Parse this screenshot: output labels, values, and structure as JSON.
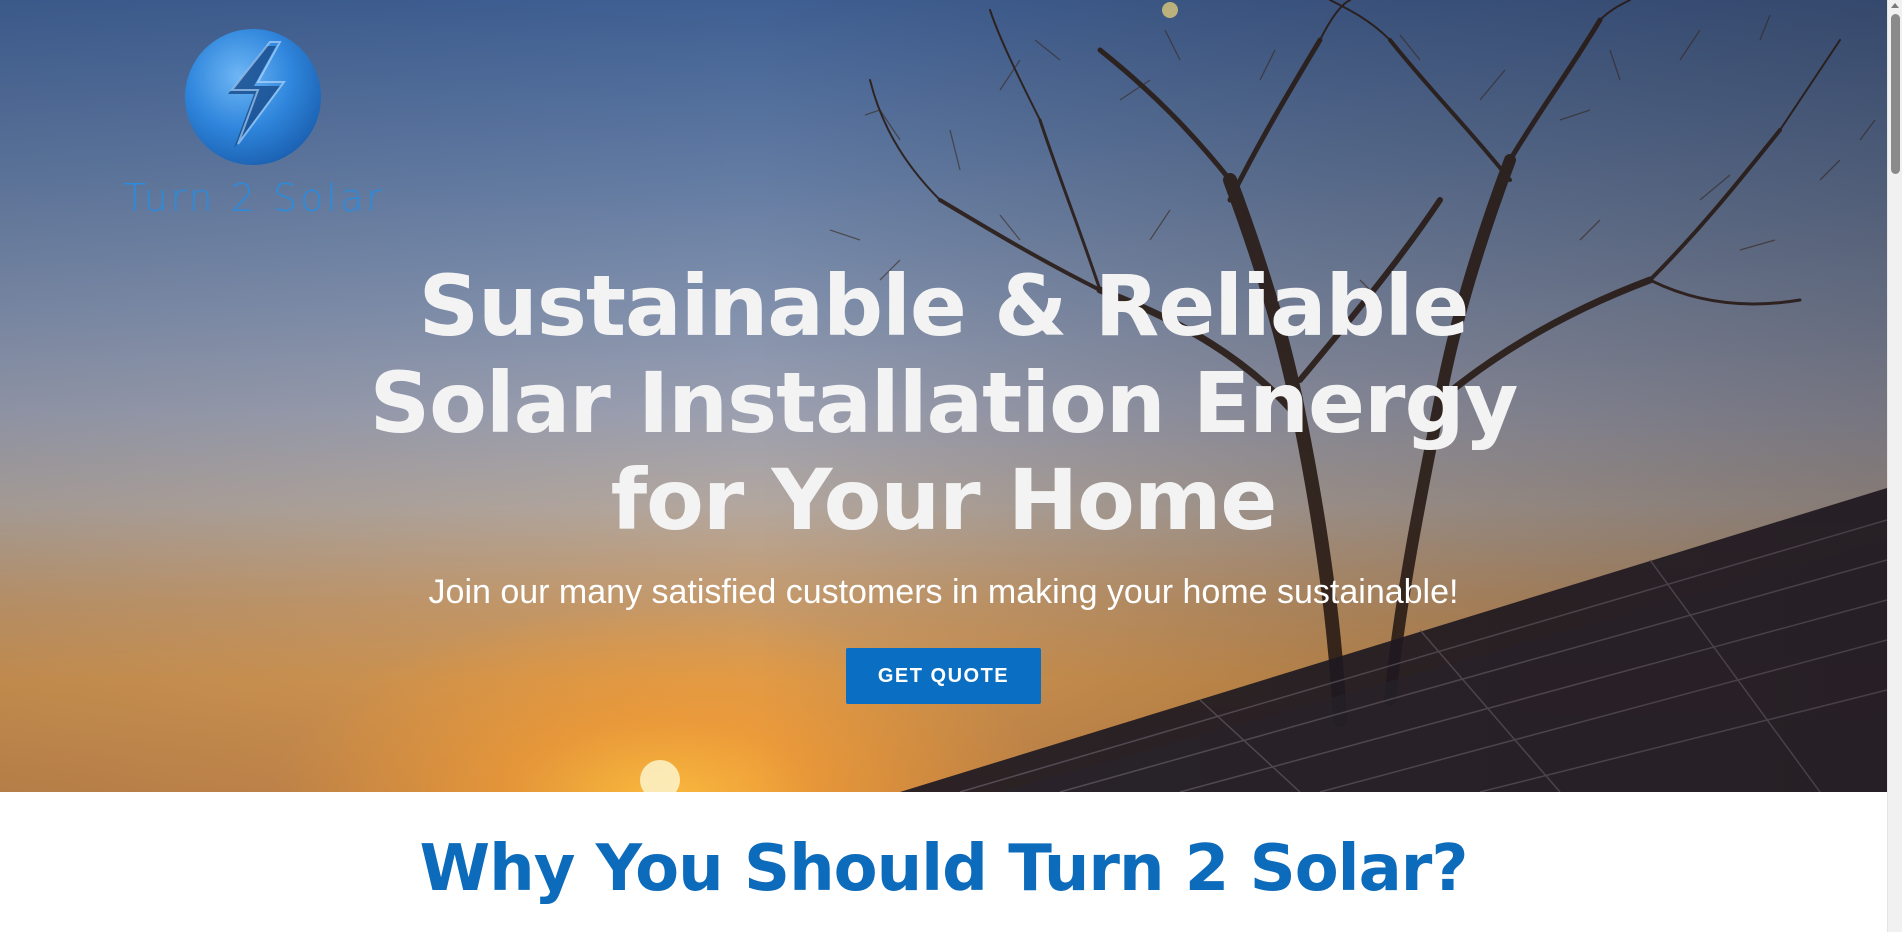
{
  "logo": {
    "text": "Turn 2 Solar",
    "icon": "lightning-bolt-icon",
    "color": "#2b8bdc"
  },
  "hero": {
    "title": "Sustainable & Reliable Solar Installation Energy for Your Home",
    "subtitle": "Join our many satisfied customers in making your home sustainable!",
    "cta_label": "GET QUOTE",
    "cta_color": "#0a6fc2"
  },
  "why_section": {
    "heading": "Why You Should Turn 2 Solar?",
    "heading_color": "#0d6bbb"
  }
}
